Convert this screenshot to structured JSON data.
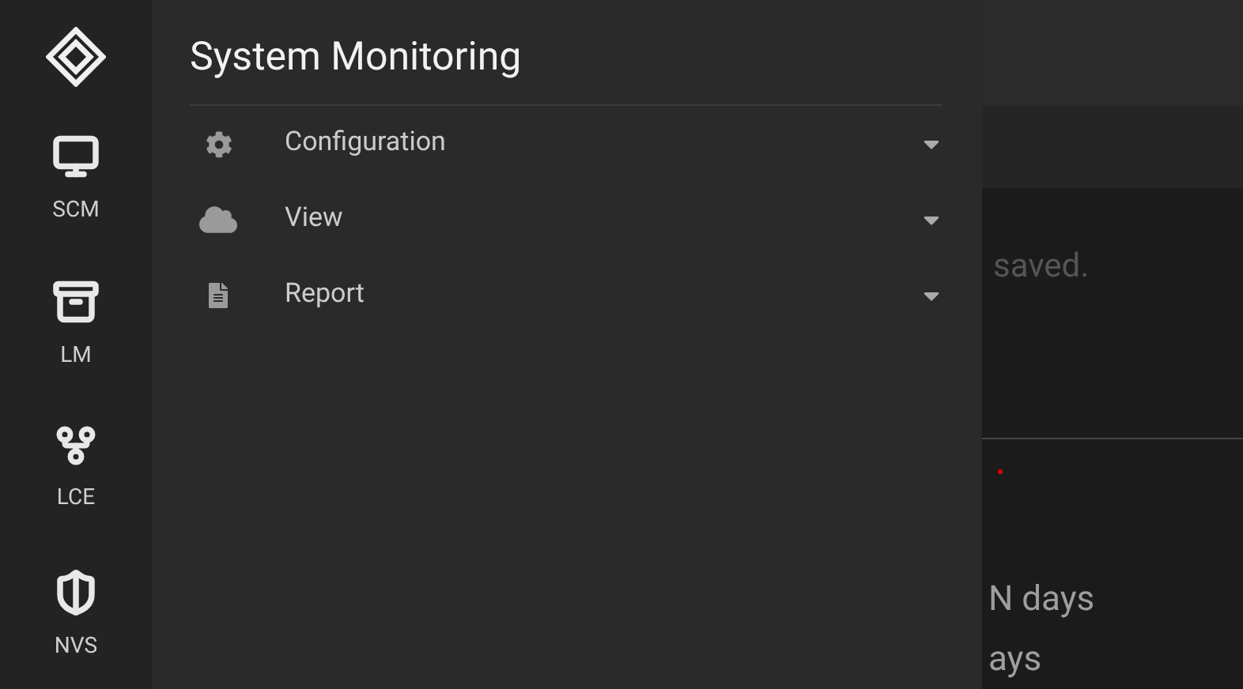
{
  "rail": {
    "items": [
      {
        "label": "SCM",
        "kind": "monitor"
      },
      {
        "label": "LM",
        "kind": "archive"
      },
      {
        "label": "LCE",
        "kind": "branch"
      },
      {
        "label": "NVS",
        "kind": "shield"
      }
    ]
  },
  "panel": {
    "title": "System Monitoring",
    "items": [
      {
        "label": "Configuration",
        "kind": "gear"
      },
      {
        "label": "View",
        "kind": "cloud"
      },
      {
        "label": "Report",
        "kind": "file"
      }
    ]
  },
  "background": {
    "texts": [
      "saved.",
      "N days",
      "ays"
    ]
  }
}
